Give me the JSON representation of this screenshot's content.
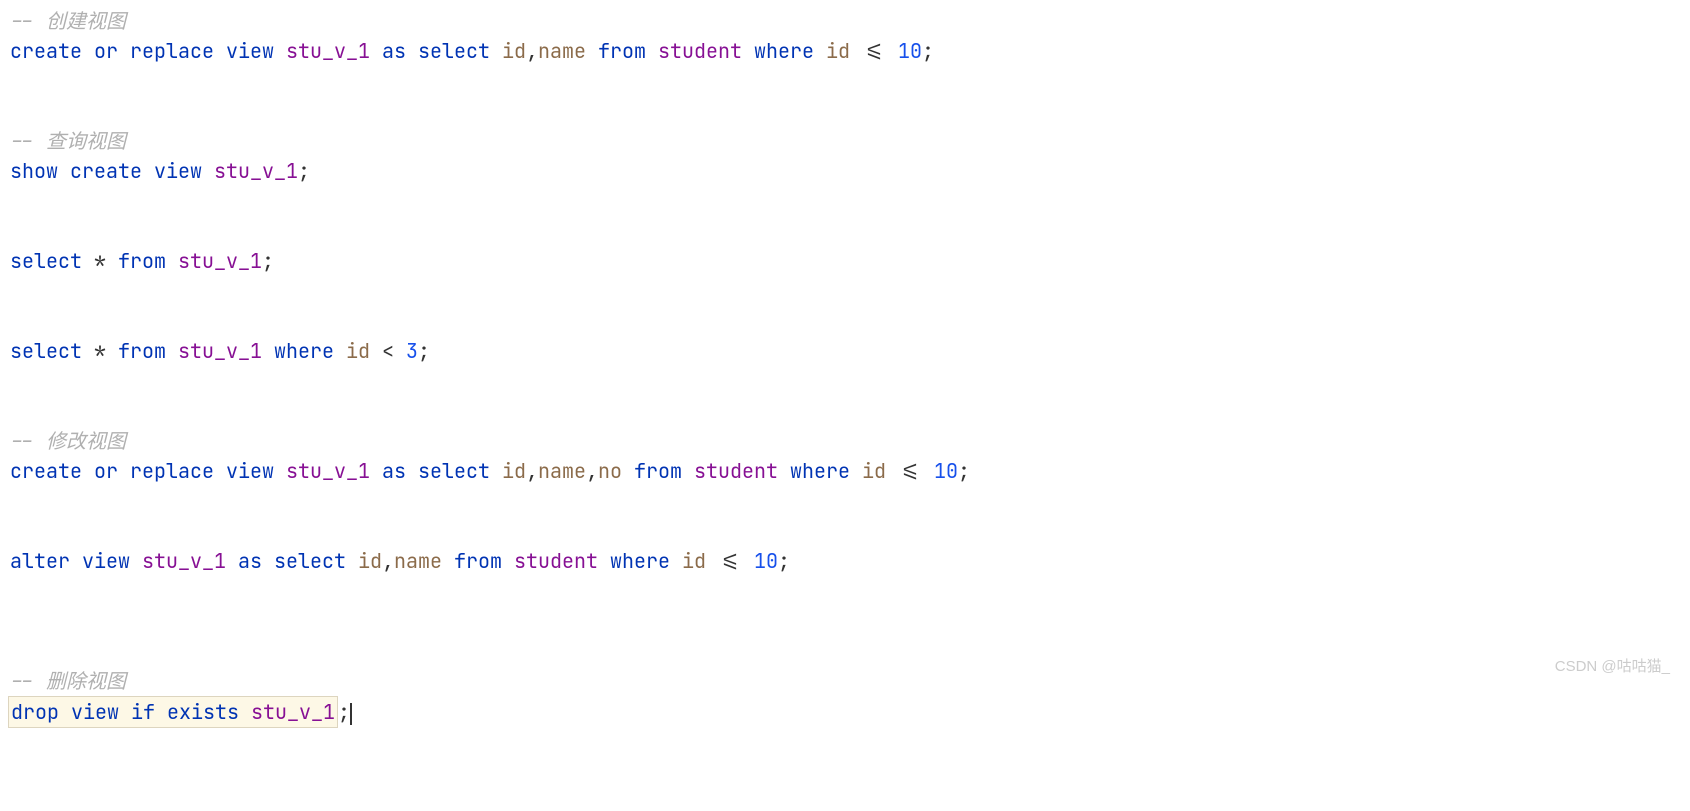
{
  "code": {
    "comment1": "-- 创建视图",
    "line1": {
      "k1": "create",
      "k2": "or",
      "k3": "replace",
      "k4": "view",
      "id1": "stu_v_1",
      "k5": "as",
      "k6": "select",
      "field1": "id",
      "comma1": ",",
      "field2": "name",
      "k7": "from",
      "table1": "student",
      "k8": "where",
      "field3": "id",
      "op1": "<=",
      "num1": "10",
      "end": ";"
    },
    "comment2": "-- 查询视图",
    "line2": {
      "k1": "show",
      "k2": "create",
      "k3": "view",
      "id1": "stu_v_1",
      "end": ";"
    },
    "line3": {
      "k1": "select",
      "star": "*",
      "k2": "from",
      "id1": "stu_v_1",
      "end": ";"
    },
    "line4": {
      "k1": "select",
      "star": "*",
      "k2": "from",
      "id1": "stu_v_1",
      "k3": "where",
      "field1": "id",
      "op1": "<",
      "num1": "3",
      "end": ";"
    },
    "comment3": "-- 修改视图",
    "line5": {
      "k1": "create",
      "k2": "or",
      "k3": "replace",
      "k4": "view",
      "id1": "stu_v_1",
      "k5": "as",
      "k6": "select",
      "field1": "id",
      "comma1": ",",
      "field2": "name",
      "comma2": ",",
      "field3": "no",
      "k7": "from",
      "table1": "student",
      "k8": "where",
      "field4": "id",
      "op1": "<=",
      "num1": "10",
      "end": ";"
    },
    "line6": {
      "k1": "alter",
      "k2": "view",
      "id1": "stu_v_1",
      "k3": "as",
      "k4": "select",
      "field1": "id",
      "comma1": ",",
      "field2": "name",
      "k5": "from",
      "table1": "student",
      "k6": "where",
      "field3": "id",
      "op1": "<=",
      "num1": "10",
      "end": ";"
    },
    "comment4": "-- 删除视图",
    "line7": {
      "k1": "drop",
      "k2": "view",
      "k3": "if",
      "k4": "exists",
      "id1": "stu_v_1",
      "end": ";"
    }
  },
  "watermark": "CSDN @咕咕猫_"
}
